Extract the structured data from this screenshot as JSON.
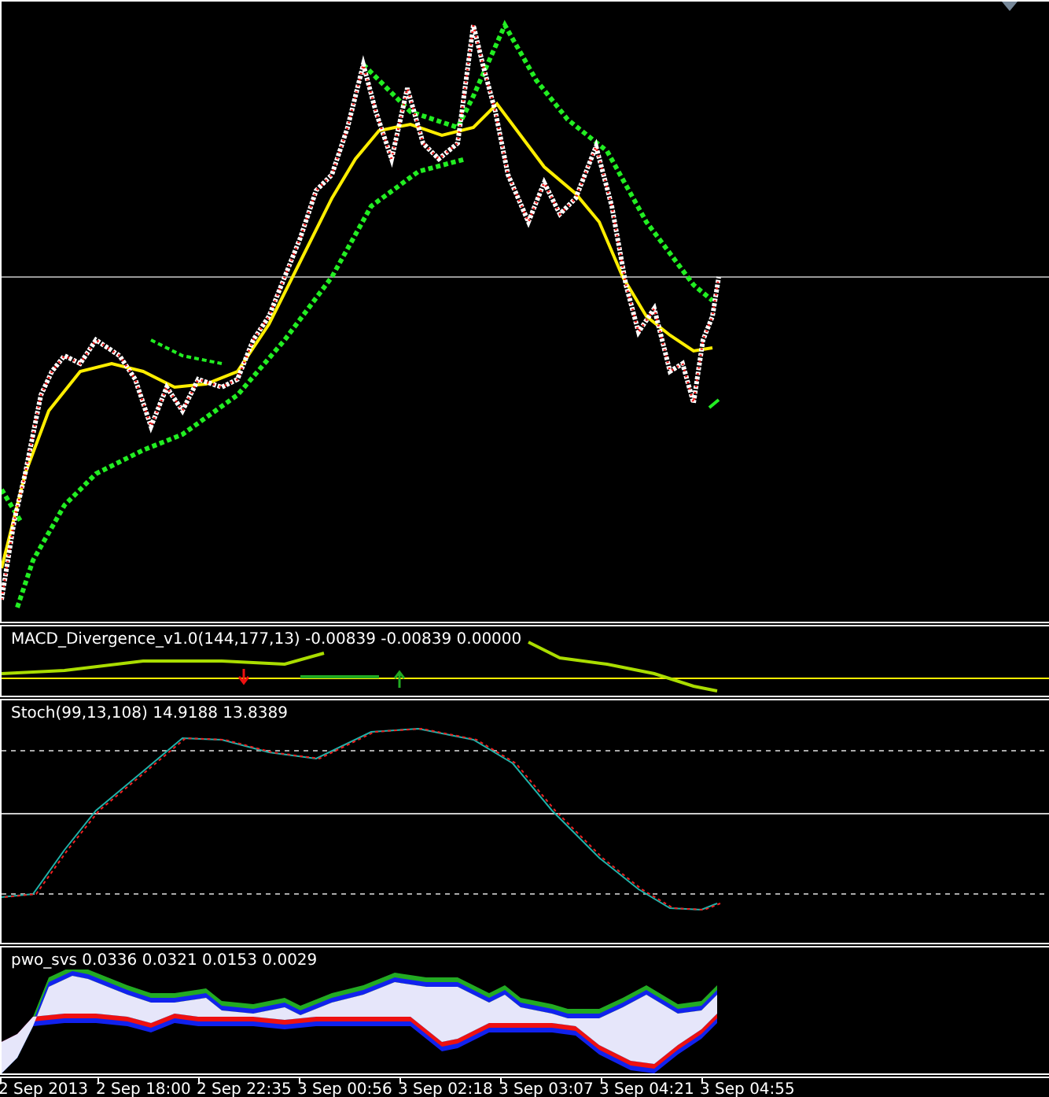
{
  "panels": [
    {
      "kind": "price"
    },
    {
      "kind": "macd",
      "label": "MACD_Divergence_v1.0(144,177,13) -0.00839 -0.00839 0.00000"
    },
    {
      "kind": "stoch",
      "label": "Stoch(99,13,108) 14.9188 13.8389"
    },
    {
      "kind": "pwo",
      "label": "pwo_svs 0.0336 0.0321 0.0153 0.0029"
    }
  ],
  "time_axis": [
    "2 Sep 2013",
    "2 Sep 18:00",
    "2 Sep 22:35",
    "3 Sep 00:56",
    "3 Sep 02:18",
    "3 Sep 03:07",
    "3 Sep 04:21",
    "3 Sep 04:55"
  ]
}
